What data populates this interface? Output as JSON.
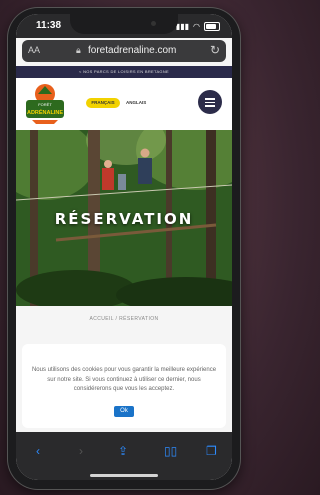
{
  "status": {
    "time": "11:38"
  },
  "browser": {
    "text_size": "AA",
    "url": "foretadrenaline.com",
    "icons": {
      "lock": "lock-icon",
      "reload": "reload-icon"
    }
  },
  "site": {
    "promo": "< NOS PARCS DE LOISIRS EN BRETAGNE",
    "logo_text": {
      "top": "FORÊT",
      "main": "ADRÉNALINE"
    },
    "lang": {
      "fr": "FRANÇAIS",
      "en": "ANGLAIS"
    },
    "hero_title": "RÉSERVATION",
    "breadcrumb": "ACCUEIL / RÉSERVATION"
  },
  "cookie": {
    "text": "Nous utilisons des cookies pour vous garantir la meilleure expérience sur notre site. Si vous continuez à utiliser ce dernier, nous considérerons que vous les acceptez.",
    "ok": "Ok"
  },
  "toolbar": {
    "icons": [
      "back-icon",
      "forward-icon",
      "share-icon",
      "bookmarks-icon",
      "tabs-icon"
    ]
  },
  "colors": {
    "accent": "#f2d200",
    "nav": "#2c2c4a",
    "ios_blue": "#2d8cff"
  }
}
